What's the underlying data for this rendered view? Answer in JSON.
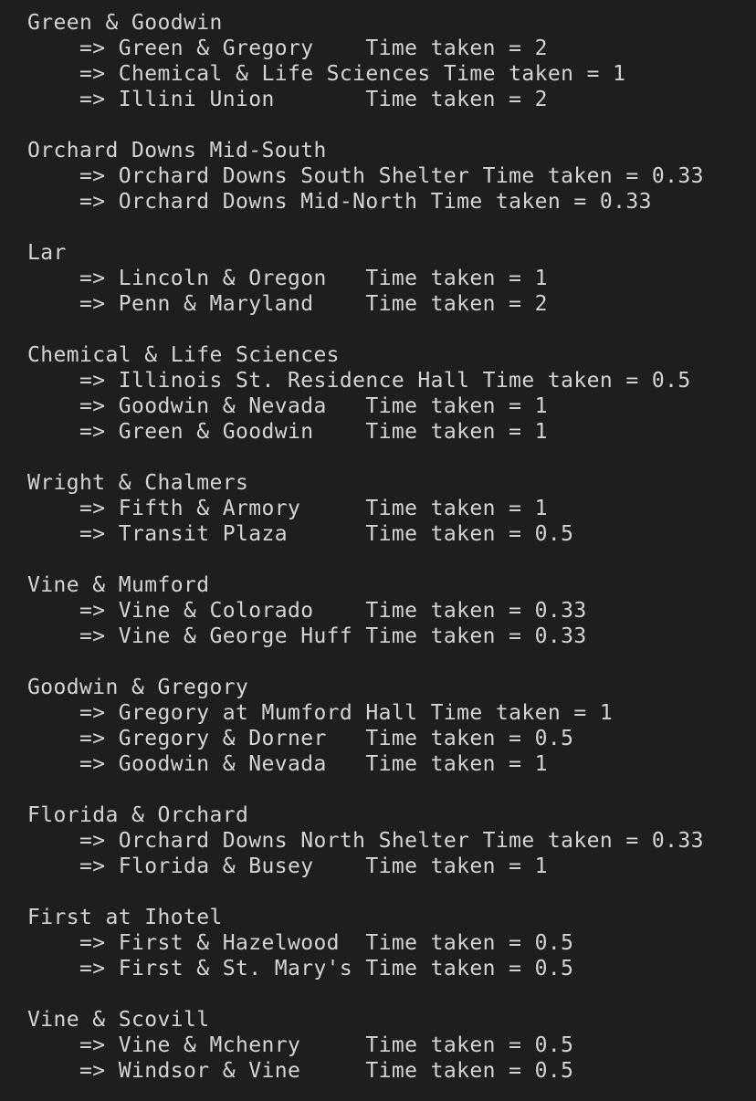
{
  "terminal": {
    "lines": [
      "Green & Goodwin",
      "    => Green & Gregory    Time taken = 2",
      "    => Chemical & Life Sciences Time taken = 1",
      "    => Illini Union       Time taken = 2",
      "",
      "Orchard Downs Mid-South",
      "    => Orchard Downs South Shelter Time taken = 0.33",
      "    => Orchard Downs Mid-North Time taken = 0.33",
      "",
      "Lar",
      "    => Lincoln & Oregon   Time taken = 1",
      "    => Penn & Maryland    Time taken = 2",
      "",
      "Chemical & Life Sciences",
      "    => Illinois St. Residence Hall Time taken = 0.5",
      "    => Goodwin & Nevada   Time taken = 1",
      "    => Green & Goodwin    Time taken = 1",
      "",
      "Wright & Chalmers",
      "    => Fifth & Armory     Time taken = 1",
      "    => Transit Plaza      Time taken = 0.5",
      "",
      "Vine & Mumford",
      "    => Vine & Colorado    Time taken = 0.33",
      "    => Vine & George Huff Time taken = 0.33",
      "",
      "Goodwin & Gregory",
      "    => Gregory at Mumford Hall Time taken = 1",
      "    => Gregory & Dorner   Time taken = 0.5",
      "    => Goodwin & Nevada   Time taken = 1",
      "",
      "Florida & Orchard",
      "    => Orchard Downs North Shelter Time taken = 0.33",
      "    => Florida & Busey    Time taken = 1",
      "",
      "First at Ihotel",
      "    => First & Hazelwood  Time taken = 0.5",
      "    => First & St. Mary's Time taken = 0.5",
      "",
      "Vine & Scovill",
      "    => Vine & Mchenry     Time taken = 0.5",
      "    => Windsor & Vine     Time taken = 0.5"
    ],
    "text_color": "#d4d4d4",
    "background_color": "#1e1e1e"
  }
}
